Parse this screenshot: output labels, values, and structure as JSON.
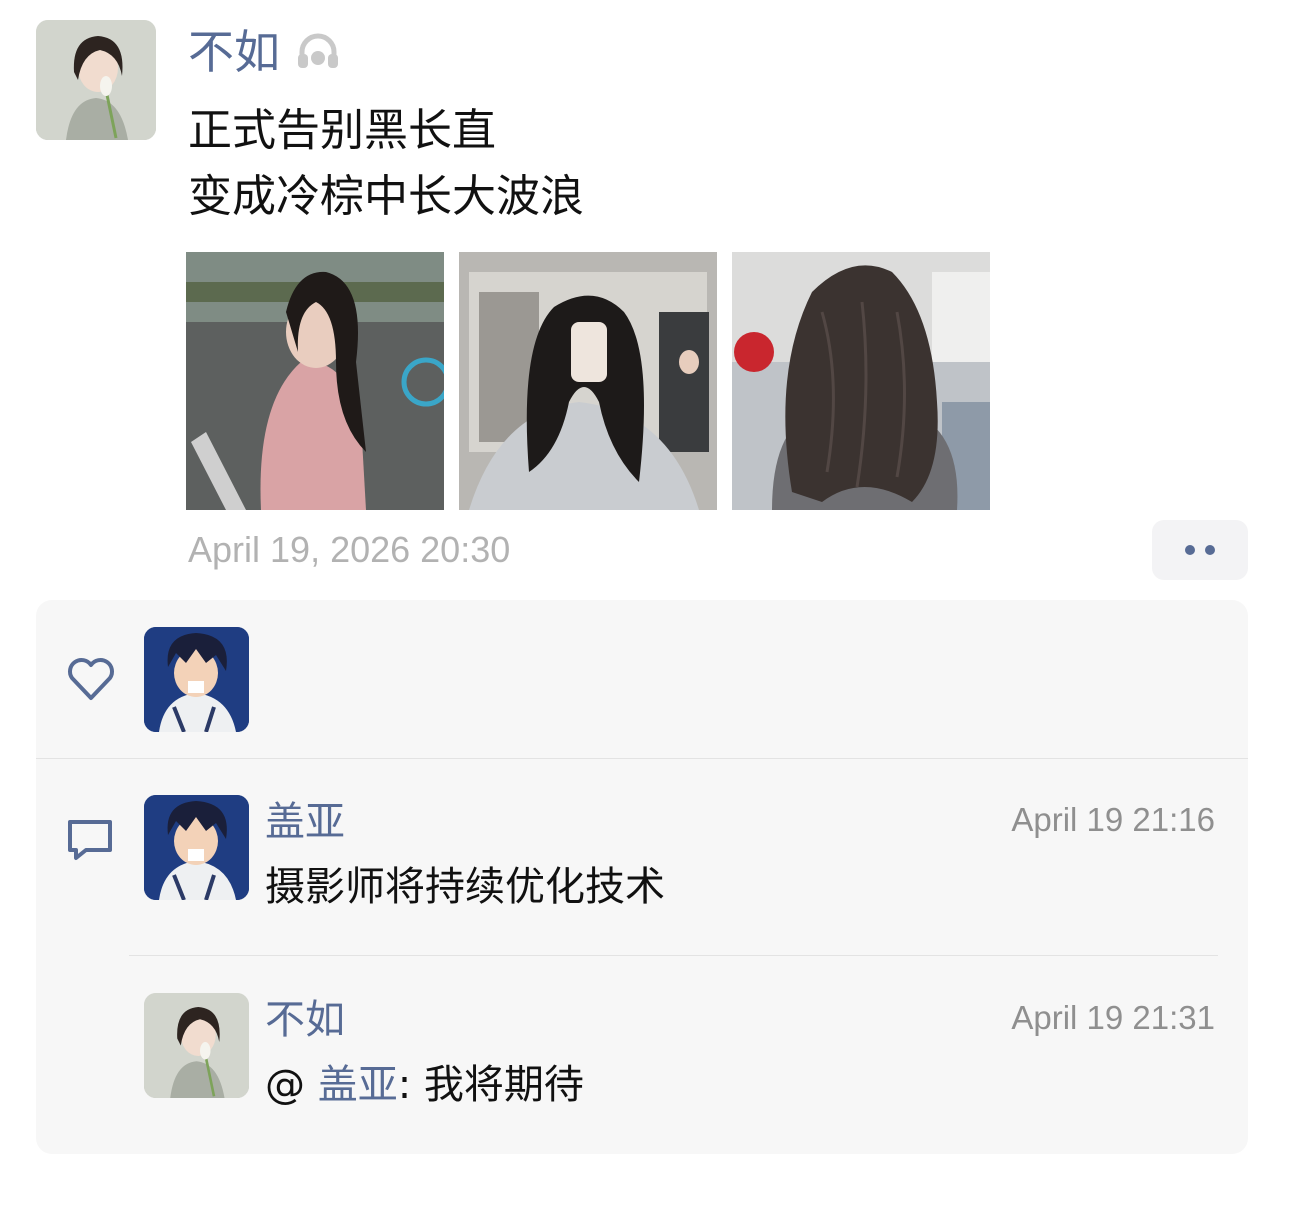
{
  "post": {
    "author": "不如",
    "lines": [
      "正式告别黑长直",
      "变成冷棕中长大波浪"
    ],
    "timestamp": "April 19, 2026 20:30",
    "photos": [
      "photo-street",
      "photo-mirror-selfie",
      "photo-back-hair"
    ],
    "more_icon": "more-dots-icon",
    "visibility_icon": "headphones-icon"
  },
  "likes": {
    "icon": "heart-icon",
    "users": [
      "盖亚"
    ]
  },
  "comments": {
    "icon": "comment-bubble-icon",
    "items": [
      {
        "user": "盖亚",
        "time": "April 19 21:16",
        "text": "摄影师将持续优化技术"
      },
      {
        "user": "不如",
        "time": "April 19 21:31",
        "prefix": "@ ",
        "mention": "盖亚",
        "separator": ": ",
        "text": "我将期待"
      }
    ]
  },
  "colors": {
    "link": "#576b95",
    "panel_bg": "#f7f7f7",
    "timestamp": "#b2b2b2"
  }
}
